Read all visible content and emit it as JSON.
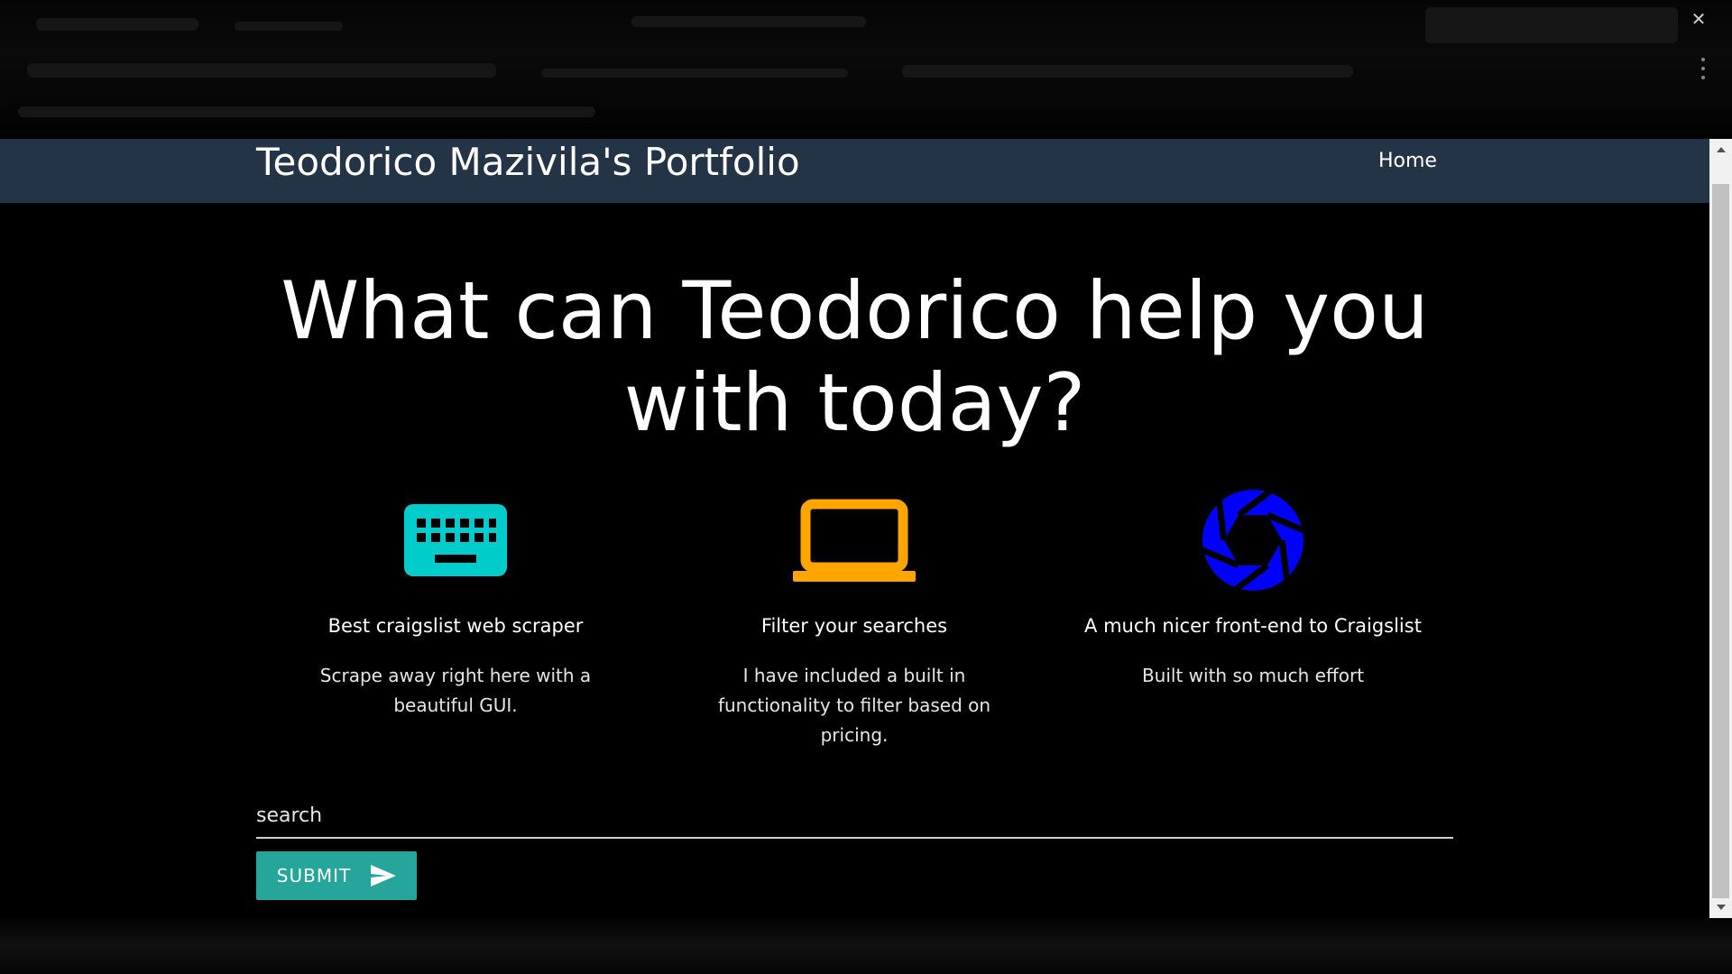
{
  "navbar": {
    "brand": "Teodorico Mazivila's Portfolio",
    "home_link": "Home"
  },
  "main": {
    "headline": "What can Teodorico help you with today?",
    "features": [
      {
        "icon": "keyboard-icon",
        "icon_color": "#00CCCC",
        "title": "Best craigslist web scraper",
        "description": "Scrape away right here with a beautiful GUI."
      },
      {
        "icon": "laptop-icon",
        "icon_color": "#FFA500",
        "title": "Filter your searches",
        "description": "I have included a built in functionality to filter based on pricing."
      },
      {
        "icon": "camera-shutter-icon",
        "icon_color": "#0000FF",
        "title": "A much nicer front-end to Craigslist",
        "description": "Built with so much effort"
      }
    ],
    "search": {
      "placeholder": "search",
      "value": ""
    },
    "submit_label": "SUBMIT",
    "submit_icon": "send-icon",
    "submit_color": "#26A69A"
  },
  "colors": {
    "navbar_bg": "#243447",
    "page_bg": "#000000"
  }
}
